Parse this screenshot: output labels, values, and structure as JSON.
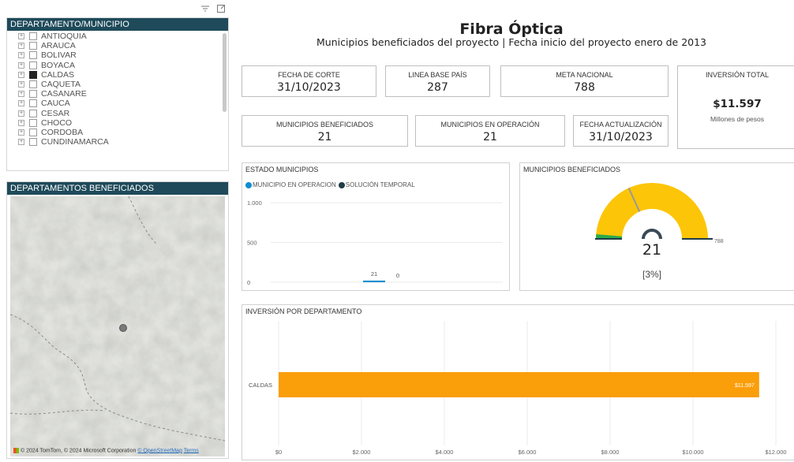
{
  "slicer": {
    "header": "DEPARTAMENTO/MUNICIPIO",
    "items": [
      {
        "label": "ANTIOQUIA",
        "checked": false
      },
      {
        "label": "ARAUCA",
        "checked": false
      },
      {
        "label": "BOLIVAR",
        "checked": false
      },
      {
        "label": "BOYACA",
        "checked": false
      },
      {
        "label": "CALDAS",
        "checked": true
      },
      {
        "label": "CAQUETA",
        "checked": false
      },
      {
        "label": "CASANARE",
        "checked": false
      },
      {
        "label": "CAUCA",
        "checked": false
      },
      {
        "label": "CESAR",
        "checked": false
      },
      {
        "label": "CHOCO",
        "checked": false
      },
      {
        "label": "CORDOBA",
        "checked": false
      },
      {
        "label": "CUNDINAMARCA",
        "checked": false
      }
    ]
  },
  "toolbar": {
    "filter_icon": "filter-icon",
    "focus_icon": "focus-mode-icon"
  },
  "map": {
    "header": "DEPARTAMENTOS BENEFICIADOS",
    "attribution": "© 2024 TomTom, © 2024 Microsoft Corporation",
    "osm_link": "© OpenStreetMap",
    "terms_link": "Terms"
  },
  "title": "Fibra Óptica",
  "subtitle": "Municipios beneficiados del proyecto | Fecha inicio del proyecto enero de 2013",
  "kpis": {
    "fecha_corte": {
      "label": "FECHA DE CORTE",
      "value": "31/10/2023"
    },
    "linea_base": {
      "label": "LINEA BASE PAÍS",
      "value": "287"
    },
    "meta_nacional": {
      "label": "META NACIONAL",
      "value": "788"
    },
    "inversion_total": {
      "label": "INVERSIÓN TOTAL",
      "value": "$11.597",
      "sub": "Millones de pesos"
    },
    "municipios_beneficiados": {
      "label": "MUNICIPIOS BENEFICIADOS",
      "value": "21"
    },
    "municipios_operacion": {
      "label": "MUNICIPIOS EN OPERACIÓN",
      "value": "21"
    },
    "fecha_actualizacion": {
      "label": "FECHA ACTUALIZACIÓN",
      "value": "31/10/2023"
    }
  },
  "estado": {
    "title": "ESTADO  MUNICIPIOS",
    "legend": [
      {
        "name": "MUNICIPIO EN OPERACION",
        "color": "#118dce"
      },
      {
        "name": "SOLUCIÓN TEMPORAL",
        "color": "#1f3c48"
      }
    ]
  },
  "gauge": {
    "title": "MUNICIPIOS BENEFICIADOS",
    "value": "21",
    "max_label": "788",
    "percent_label": "[3%]",
    "value_num": 21,
    "max_num": 788,
    "target_num": 287,
    "colors": {
      "fill": "#fdc507",
      "value": "#2ba94a",
      "target": "#1f3c48"
    }
  },
  "inversion": {
    "title": "INVERSIÓN POR DEPARTAMENTO"
  },
  "colors": {
    "header_bg": "#1e4a5a",
    "bar": "#fa9e0a",
    "accent": "#118dce"
  },
  "chart_data": [
    {
      "type": "bar",
      "title": "ESTADO  MUNICIPIOS",
      "categories": [
        ""
      ],
      "series": [
        {
          "name": "MUNICIPIO EN OPERACION",
          "values": [
            21
          ],
          "color": "#118dce"
        },
        {
          "name": "SOLUCIÓN TEMPORAL",
          "values": [
            0
          ],
          "color": "#1f3c48"
        }
      ],
      "data_labels": [
        "21",
        "0"
      ],
      "y_ticks": [
        "0",
        "500",
        "1.000"
      ],
      "ylim": [
        0,
        1100
      ],
      "grid": true,
      "legend": "top-left"
    },
    {
      "type": "bar",
      "orientation": "horizontal",
      "title": "INVERSIÓN POR DEPARTAMENTO",
      "categories": [
        "CALDAS"
      ],
      "values": [
        11597
      ],
      "data_labels": [
        "$11.597"
      ],
      "x_ticks": [
        "$0",
        "$2.000",
        "$4.000",
        "$6.000",
        "$8.000",
        "$10.000",
        "$12.000"
      ],
      "xlim": [
        0,
        12000
      ],
      "grid": true
    }
  ]
}
